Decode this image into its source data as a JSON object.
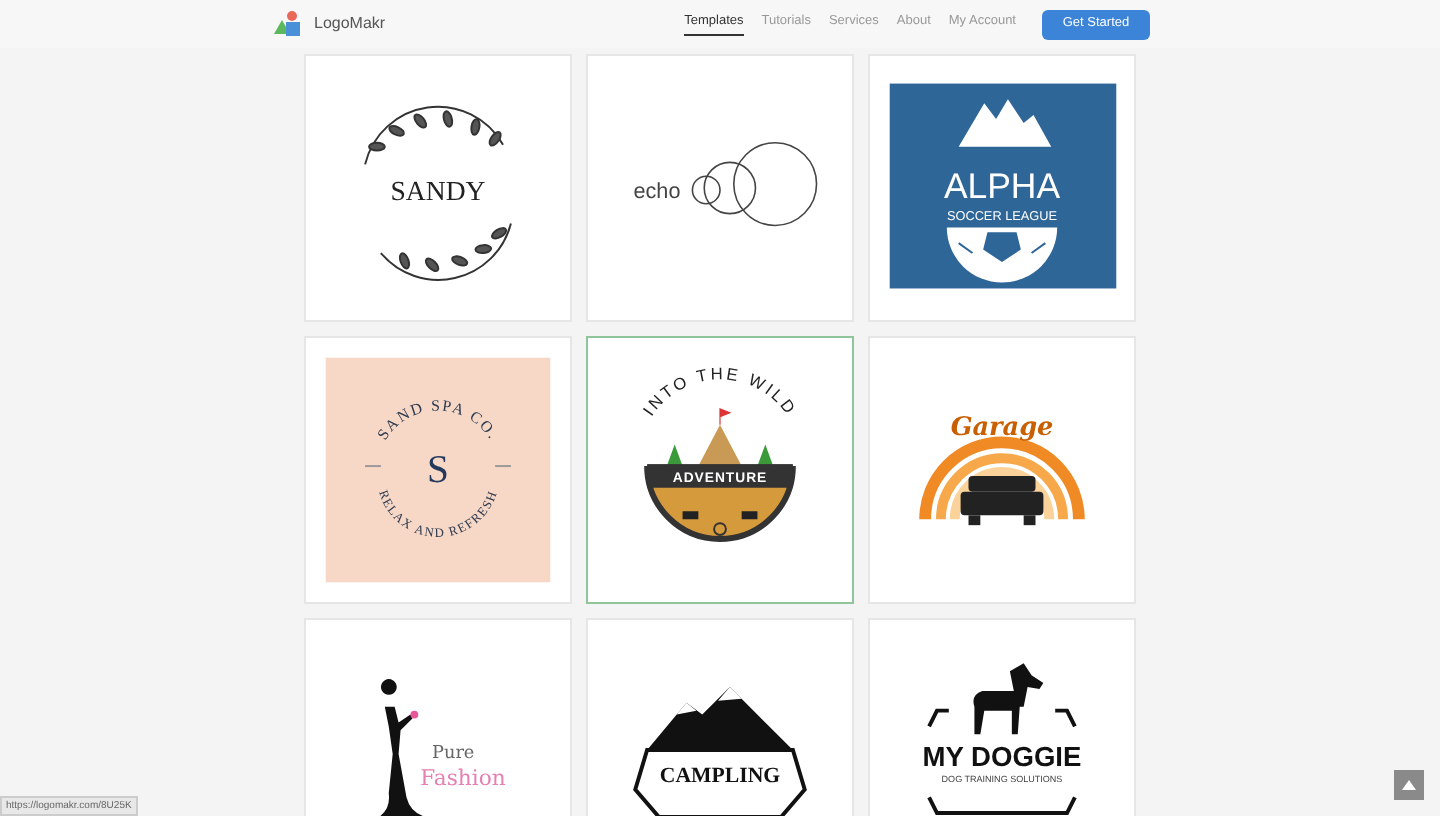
{
  "navbar": {
    "brand": "LogoMakr",
    "links": [
      {
        "label": "Templates",
        "selected": true
      },
      {
        "label": "Tutorials",
        "selected": false
      },
      {
        "label": "Services",
        "selected": false
      },
      {
        "label": "About",
        "selected": false
      },
      {
        "label": "My Account",
        "selected": false
      }
    ],
    "cta": "Get Started"
  },
  "templates": [
    {
      "kind": "wreath",
      "selected": false,
      "texts": [
        "SANDY"
      ]
    },
    {
      "kind": "circles",
      "selected": false,
      "texts": [
        "echo"
      ]
    },
    {
      "kind": "soccer",
      "selected": false,
      "texts": [
        "ALPHA",
        "SOCCER LEAGUE"
      ]
    },
    {
      "kind": "spa",
      "selected": false,
      "texts": [
        "SAND SPA CO.",
        "S",
        "RELAX AND REFRESH"
      ]
    },
    {
      "kind": "wild",
      "selected": true,
      "texts": [
        "INTO THE WILD",
        "ADVENTURE"
      ]
    },
    {
      "kind": "garage",
      "selected": false,
      "texts": [
        "Garage"
      ]
    },
    {
      "kind": "fashion",
      "selected": false,
      "texts": [
        "Pure",
        "Fashion"
      ]
    },
    {
      "kind": "camping",
      "selected": false,
      "texts": [
        "CAMPLING"
      ]
    },
    {
      "kind": "dog",
      "selected": false,
      "texts": [
        "MY DOGGIE",
        "DOG TRAINING SOLUTIONS"
      ]
    }
  ],
  "status_url": "https://logomakr.com/8U25K"
}
